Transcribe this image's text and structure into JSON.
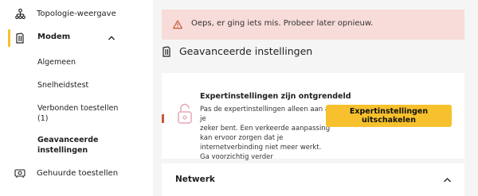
{
  "sidebar": {
    "top_item": {
      "label": "Topologie-weergave",
      "icon": "topology-icon"
    },
    "modem": {
      "label": "Modem",
      "icon": "modem-icon",
      "expanded": true
    },
    "sub_items": [
      {
        "label": "Algemeen"
      },
      {
        "label": "Snelheidstest"
      },
      {
        "label_line1": "Verbonden toestellen",
        "label_line2": "(1)"
      },
      {
        "label_line1": "Geavanceerde",
        "label_line2": "instellingen",
        "active": true
      }
    ],
    "bottom_item": {
      "label": "Gehuurde toestellen",
      "icon": "rented-devices-icon"
    }
  },
  "alert": {
    "message": "Oeps, er ging iets mis. Probeer later opnieuw.",
    "icon": "warning-icon",
    "color": "#f7dcd9"
  },
  "section": {
    "title": "Geavanceerde instellingen",
    "icon": "modem-icon"
  },
  "card": {
    "title": "Expertinstellingen zijn ontgrendeld",
    "desc_lines": [
      "Pas de expertinstellingen alleen aan als je",
      "zeker bent. Een verkeerde aanpassing",
      "kan ervoor zorgen dat je",
      "internetverbinding niet meer werkt.",
      "Ga voorzichtig verder"
    ],
    "button_label": "Expertinstellingen uitschakelen",
    "icon": "unlocked-lock-icon"
  },
  "accordion": {
    "label": "Netwerk",
    "icon": "chevron-up-icon"
  },
  "colors": {
    "accent": "#f6c12c",
    "alert_bg": "#f7dcd9",
    "alert_icon": "#c9573a",
    "page_bg": "#f5f5f5"
  }
}
